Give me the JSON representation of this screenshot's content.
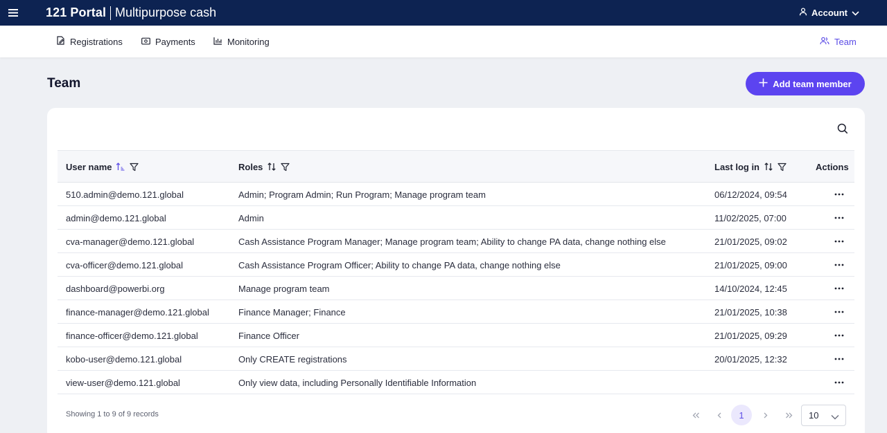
{
  "header": {
    "brand": "121 Portal",
    "program": "Multipurpose cash",
    "account_label": "Account"
  },
  "nav": {
    "registrations": "Registrations",
    "payments": "Payments",
    "monitoring": "Monitoring",
    "team": "Team"
  },
  "page": {
    "title": "Team",
    "add_button": "Add team member"
  },
  "table": {
    "columns": {
      "user_name": "User name",
      "roles": "Roles",
      "last_login": "Last log in",
      "actions": "Actions"
    },
    "rows": [
      {
        "user": "510.admin@demo.121.global",
        "roles": "Admin; Program Admin; Run Program; Manage program team",
        "last_login": "06/12/2024, 09:54"
      },
      {
        "user": "admin@demo.121.global",
        "roles": "Admin",
        "last_login": "11/02/2025, 07:00"
      },
      {
        "user": "cva-manager@demo.121.global",
        "roles": "Cash Assistance Program Manager; Manage program team; Ability to change PA data, change nothing else",
        "last_login": "21/01/2025, 09:02"
      },
      {
        "user": "cva-officer@demo.121.global",
        "roles": "Cash Assistance Program Officer; Ability to change PA data, change nothing else",
        "last_login": "21/01/2025, 09:00"
      },
      {
        "user": "dashboard@powerbi.org",
        "roles": "Manage program team",
        "last_login": "14/10/2024, 12:45"
      },
      {
        "user": "finance-manager@demo.121.global",
        "roles": "Finance Manager; Finance",
        "last_login": "21/01/2025, 10:38"
      },
      {
        "user": "finance-officer@demo.121.global",
        "roles": "Finance Officer",
        "last_login": "21/01/2025, 09:29"
      },
      {
        "user": "kobo-user@demo.121.global",
        "roles": "Only CREATE registrations",
        "last_login": "20/01/2025, 12:32"
      },
      {
        "user": "view-user@demo.121.global",
        "roles": "Only view data, including Personally Identifiable Information",
        "last_login": ""
      }
    ]
  },
  "pagination": {
    "summary": "Showing 1 to 9 of 9 records",
    "current_page": "1",
    "rows_per_page": "10"
  },
  "colors": {
    "header_bg": "#0d2352",
    "accent": "#5c44f0",
    "page_bg": "#eef0f4"
  },
  "icons": [
    "menu-icon",
    "user-icon",
    "chevron-down-icon",
    "registrations-icon",
    "payments-icon",
    "monitoring-icon",
    "team-icon",
    "plus-icon",
    "search-icon",
    "sort-asc-icon",
    "sort-icon",
    "filter-icon",
    "more-icon",
    "first-page-icon",
    "prev-page-icon",
    "next-page-icon",
    "last-page-icon"
  ]
}
